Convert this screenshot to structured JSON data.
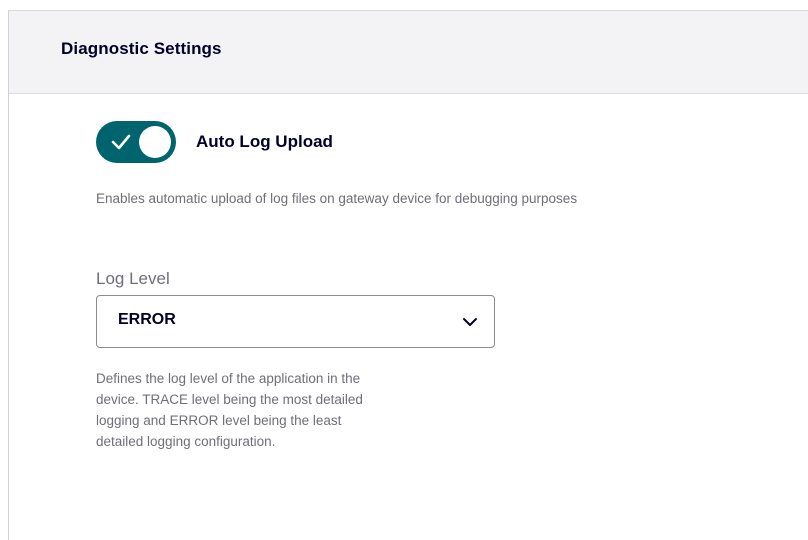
{
  "panel": {
    "title": "Diagnostic Settings"
  },
  "auto_log_upload": {
    "label": "Auto Log Upload",
    "enabled": true,
    "description": "Enables automatic upload of log files on gateway device for debugging purposes",
    "toggle_color": "#00646e"
  },
  "log_level": {
    "label": "Log Level",
    "selected": "ERROR",
    "help_lines": [
      "Defines the log level of the application in the",
      "device. TRACE level being the most detailed",
      "logging and ERROR level being the least",
      "detailed logging configuration."
    ]
  },
  "icons": {
    "toggle_check": "check-icon",
    "select_chevron": "chevron-down-icon"
  }
}
